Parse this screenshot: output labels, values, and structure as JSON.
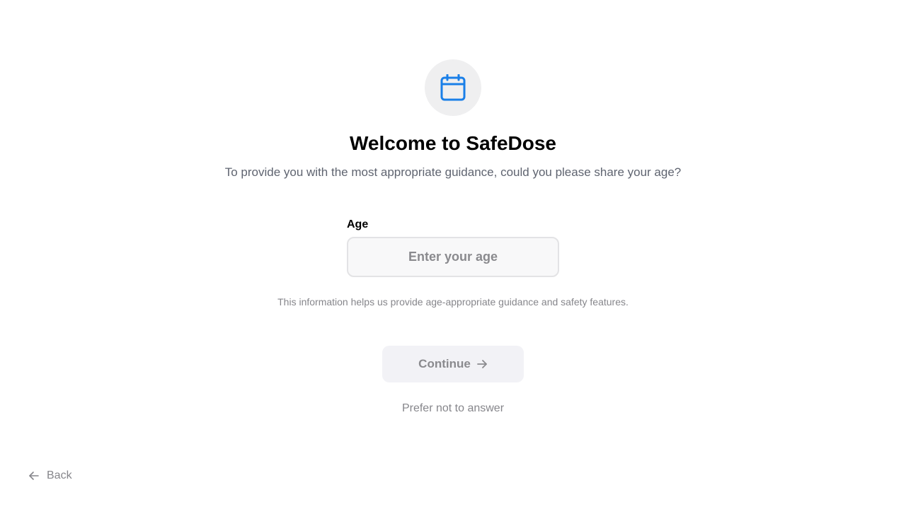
{
  "header": {
    "icon": "calendar-icon",
    "title": "Welcome to SafeDose",
    "subtitle": "To provide you with the most appropriate guidance, could you please share your age?"
  },
  "age_field": {
    "label": "Age",
    "placeholder": "Enter your age",
    "value": ""
  },
  "helper_text": "This information helps us provide age-appropriate guidance and safety features.",
  "actions": {
    "continue_label": "Continue",
    "continue_icon": "arrow-right-icon",
    "continue_enabled": false,
    "prefer_not_label": "Prefer not to answer",
    "back_label": "Back",
    "back_icon": "arrow-left-icon"
  },
  "colors": {
    "accent": "#1a7fe8",
    "icon_bg": "#efeff0",
    "muted_text": "#86868b",
    "button_disabled_bg": "#f2f2f6"
  }
}
